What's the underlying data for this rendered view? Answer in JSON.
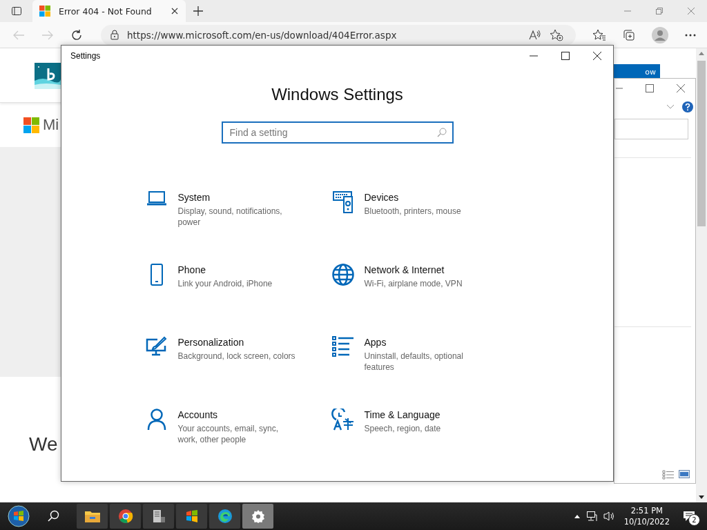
{
  "browser": {
    "tab": {
      "title": "Error 404 - Not Found",
      "selected": true
    },
    "address": "https://www.microsoft.com/en-us/download/404Error.aspx"
  },
  "page": {
    "logo_text": "Mi",
    "banner_text": "ow",
    "heading": "We"
  },
  "settings": {
    "title": "Settings",
    "heading": "Windows Settings",
    "search": {
      "placeholder": "Find a setting"
    },
    "categories": [
      {
        "kind": "system",
        "name": "System",
        "description": "Display, sound, notifications, power"
      },
      {
        "kind": "devices",
        "name": "Devices",
        "description": "Bluetooth, printers, mouse"
      },
      {
        "kind": "phone",
        "name": "Phone",
        "description": "Link your Android, iPhone"
      },
      {
        "kind": "network",
        "name": "Network & Internet",
        "description": "Wi-Fi, airplane mode, VPN"
      },
      {
        "kind": "personalization",
        "name": "Personalization",
        "description": "Background, lock screen, colors"
      },
      {
        "kind": "apps",
        "name": "Apps",
        "description": "Uninstall, defaults, optional features"
      },
      {
        "kind": "accounts",
        "name": "Accounts",
        "description": "Your accounts, email, sync, work, other people"
      },
      {
        "kind": "time",
        "name": "Time & Language",
        "description": "Speech, region, date"
      }
    ]
  },
  "taskbar": {
    "apps": [
      {
        "kind": "explorer",
        "selected": false
      },
      {
        "kind": "chrome",
        "selected": false
      },
      {
        "kind": "server",
        "selected": false
      },
      {
        "kind": "flag",
        "selected": false
      },
      {
        "kind": "edge",
        "selected": false
      },
      {
        "kind": "settings",
        "selected": true
      }
    ],
    "time": "2:51 PM",
    "date": "10/10/2022",
    "notifications": "2"
  }
}
